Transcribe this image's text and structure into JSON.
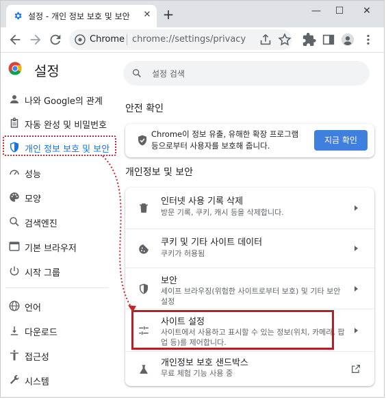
{
  "browser": {
    "tab_title": "설정 - 개인 정보 보호 및 보안",
    "tab_close": "✕",
    "new_tab": "+",
    "window_controls": {
      "minimize": "—",
      "maximize": "☐",
      "close": "✕"
    },
    "omnibox": {
      "scheme_label": "Chrome",
      "url": "chrome://settings/privacy"
    }
  },
  "sidebar": {
    "brand_title": "설정",
    "items": [
      {
        "label": "나와 Google의 관계",
        "icon": "person-icon"
      },
      {
        "label": "자동 완성 및 비밀번호",
        "icon": "clipboard-icon"
      },
      {
        "label": "개인 정보 보호 및 보안",
        "icon": "shield-icon",
        "active": true
      },
      {
        "label": "성능",
        "icon": "speedometer-icon"
      },
      {
        "label": "모양",
        "icon": "palette-icon"
      },
      {
        "label": "검색엔진",
        "icon": "search-icon"
      },
      {
        "label": "기본 브라우저",
        "icon": "browser-icon"
      },
      {
        "label": "시작 그룹",
        "icon": "power-icon"
      },
      {
        "label": "언어",
        "icon": "globe-icon"
      },
      {
        "label": "다운로드",
        "icon": "download-icon"
      },
      {
        "label": "접근성",
        "icon": "accessibility-icon"
      },
      {
        "label": "시스템",
        "icon": "wrench-icon"
      }
    ]
  },
  "main": {
    "search_placeholder": "설정 검색",
    "safety_check": {
      "title": "안전 확인",
      "text": "Chrome이 정보 유출, 유해한 확장 프로그램 등으로부터 사용자를 보호해 줍니다.",
      "button": "지금 확인"
    },
    "privacy": {
      "title": "개인정보 및 보안",
      "rows": [
        {
          "title": "인터넷 사용 기록 삭제",
          "subtitle": "방문 기록, 쿠키, 캐시 등을 삭제합니다.",
          "icon": "trash-icon"
        },
        {
          "title": "쿠키 및 기타 사이트 데이터",
          "subtitle": "쿠키가 허용됨",
          "icon": "cookie-icon"
        },
        {
          "title": "보안",
          "subtitle": "세이프 브라우징(위험한 사이트로부터 보호) 및 기타 보안 설정",
          "icon": "security-shield-icon"
        },
        {
          "title": "사이트 설정",
          "subtitle": "사이트에서 사용하고 표시할 수 있는 정보(위치, 카메라, 팝업 등)를 제어합니다.",
          "icon": "tune-icon"
        },
        {
          "title": "개인정보 보호 샌드박스",
          "subtitle": "무료 체험 기능 사용 중",
          "icon": "flask-icon"
        }
      ]
    }
  },
  "colors": {
    "accent": "#1a73e8",
    "button": "#3f7fde",
    "annotation": "#c0262d",
    "tabstrip": "#dee1e6"
  }
}
